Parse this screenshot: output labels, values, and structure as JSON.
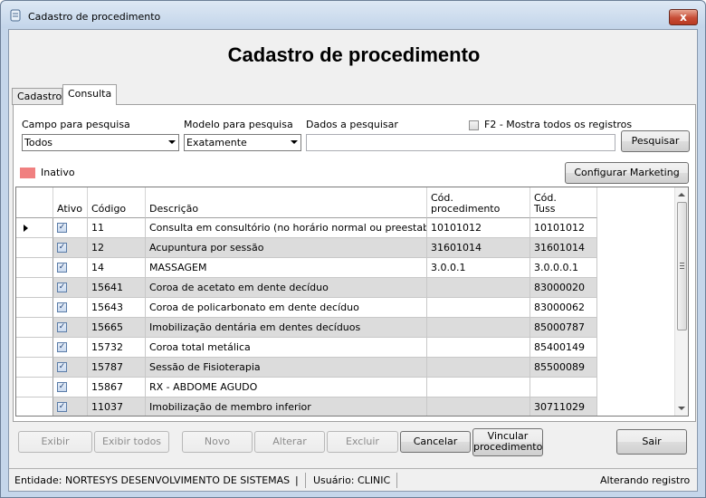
{
  "window": {
    "title": "Cadastro de procedimento",
    "close_glyph": "x"
  },
  "page_title": "Cadastro de procedimento",
  "tabs": [
    {
      "label": "Cadastro",
      "active": false
    },
    {
      "label": "Consulta",
      "active": true
    }
  ],
  "search": {
    "field_label": "Campo para pesquisa",
    "field_value": "Todos",
    "model_label": "Modelo para pesquisa",
    "model_value": "Exatamente",
    "data_label": "Dados a pesquisar",
    "data_value": "",
    "show_all_label": "F2 - Mostra todos os registros",
    "show_all_checked": false,
    "search_button": "Pesquisar"
  },
  "legend": {
    "inactive_label": "Inativo",
    "inactive_color": "#f08080"
  },
  "marketing_button": "Configurar Marketing",
  "grid": {
    "columns": [
      "Ativo",
      "Código",
      "Descrição",
      "Cód.\nprocedimento",
      "Cód.\nTuss"
    ],
    "rows": [
      {
        "ativo": true,
        "codigo": "11",
        "descricao": "Consulta em consultório (no horário normal ou preestabelecido)",
        "cod_proc": "10101012",
        "cod_tuss": "10101012",
        "current": true
      },
      {
        "ativo": true,
        "codigo": "12",
        "descricao": "Acupuntura por sessão",
        "cod_proc": "31601014",
        "cod_tuss": "31601014",
        "current": false
      },
      {
        "ativo": true,
        "codigo": "14",
        "descricao": "MASSAGEM",
        "cod_proc": "3.0.0.1",
        "cod_tuss": "3.0.0.0.1",
        "current": false
      },
      {
        "ativo": true,
        "codigo": "15641",
        "descricao": "Coroa de acetato em dente decíduo",
        "cod_proc": "",
        "cod_tuss": "83000020",
        "current": false
      },
      {
        "ativo": true,
        "codigo": "15643",
        "descricao": "Coroa de policarbonato em dente decíduo",
        "cod_proc": "",
        "cod_tuss": "83000062",
        "current": false
      },
      {
        "ativo": true,
        "codigo": "15665",
        "descricao": "Imobilização dentária em dentes decíduos",
        "cod_proc": "",
        "cod_tuss": "85000787",
        "current": false
      },
      {
        "ativo": true,
        "codigo": "15732",
        "descricao": "Coroa total metálica",
        "cod_proc": "",
        "cod_tuss": "85400149",
        "current": false
      },
      {
        "ativo": true,
        "codigo": "15787",
        "descricao": "Sessão de Fisioterapia",
        "cod_proc": "",
        "cod_tuss": "85500089",
        "current": false
      },
      {
        "ativo": true,
        "codigo": "15867",
        "descricao": "RX - ABDOME AGUDO",
        "cod_proc": "",
        "cod_tuss": "",
        "current": false
      },
      {
        "ativo": true,
        "codigo": "11037",
        "descricao": "Imobilização de membro inferior",
        "cod_proc": "",
        "cod_tuss": "30711029",
        "current": false
      },
      {
        "ativo": true,
        "codigo": "",
        "descricao": "",
        "cod_proc": "",
        "cod_tuss": "",
        "current": false
      }
    ]
  },
  "buttons": {
    "exibir": "Exibir",
    "exibir_todos": "Exibir todos",
    "novo": "Novo",
    "alterar": "Alterar",
    "excluir": "Excluir",
    "cancelar": "Cancelar",
    "vincular_line1": "Vincular",
    "vincular_line2": "procedimento",
    "sair": "Sair"
  },
  "status": {
    "entidade": "Entidade: NORTESYS DESENVOLVIMENTO DE SISTEMAS",
    "sep": "|",
    "usuario": "Usuário: CLINIC",
    "mode": "Alterando registro"
  }
}
